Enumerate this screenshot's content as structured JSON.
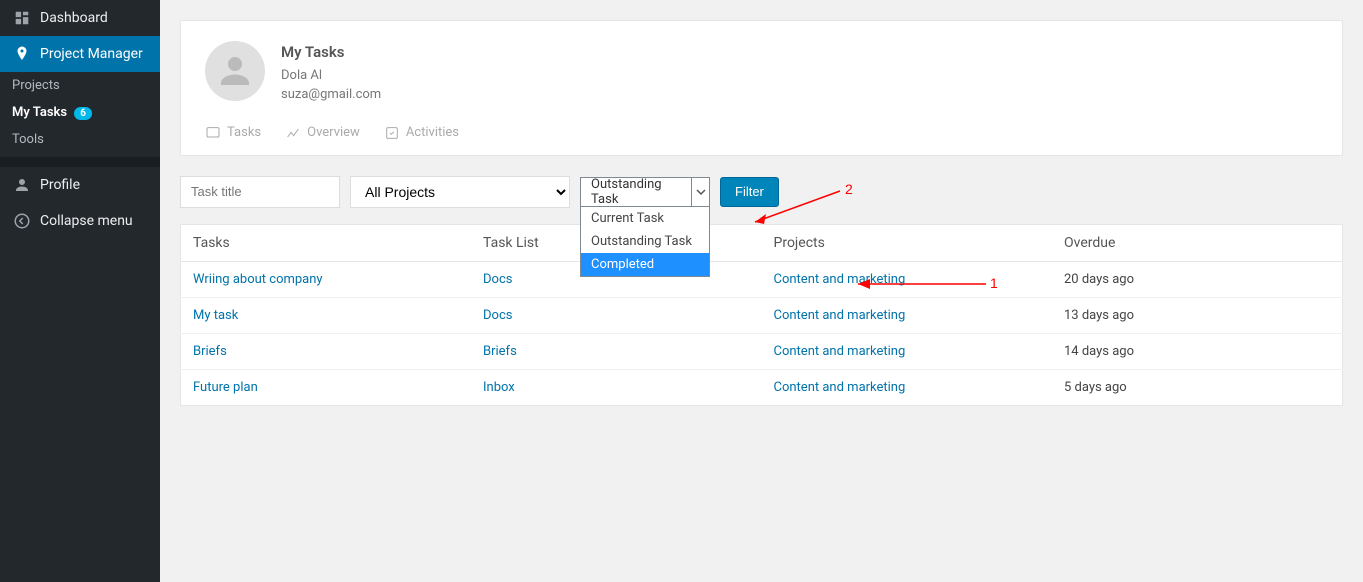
{
  "sidebar": {
    "items": [
      {
        "label": "Dashboard",
        "icon": "dashboard-icon"
      },
      {
        "label": "Project Manager",
        "icon": "pm-icon",
        "active": true
      }
    ],
    "sub": [
      {
        "label": "Projects"
      },
      {
        "label": "My Tasks",
        "badge": "6",
        "active": true
      },
      {
        "label": "Tools"
      }
    ],
    "footer": [
      {
        "label": "Profile",
        "icon": "user-icon"
      },
      {
        "label": "Collapse menu",
        "icon": "collapse-icon"
      }
    ]
  },
  "user": {
    "title": "My Tasks",
    "name": "Dola Al",
    "email": "suza@gmail.com"
  },
  "tabs": [
    {
      "label": "Tasks",
      "icon": "checklist-icon"
    },
    {
      "label": "Overview",
      "icon": "chart-icon"
    },
    {
      "label": "Activities",
      "icon": "activity-icon"
    }
  ],
  "filters": {
    "task_title_placeholder": "Task title",
    "projects_selected": "All Projects",
    "status_selected": "Outstanding Task",
    "status_options": [
      "Current Task",
      "Outstanding Task",
      "Completed"
    ],
    "filter_button": "Filter"
  },
  "table": {
    "headers": [
      "Tasks",
      "Task List",
      "Projects",
      "Overdue"
    ],
    "rows": [
      {
        "task": "Wriing about company",
        "list": "Docs",
        "project": "Content and marketing",
        "overdue": "20 days ago"
      },
      {
        "task": "My task",
        "list": "Docs",
        "project": "Content and marketing",
        "overdue": "13 days ago"
      },
      {
        "task": "Briefs",
        "list": "Briefs",
        "project": "Content and marketing",
        "overdue": "14 days ago"
      },
      {
        "task": "Future plan",
        "list": "Inbox",
        "project": "Content and marketing",
        "overdue": "5 days ago"
      }
    ]
  },
  "annotations": {
    "label1": "1",
    "label2": "2"
  }
}
